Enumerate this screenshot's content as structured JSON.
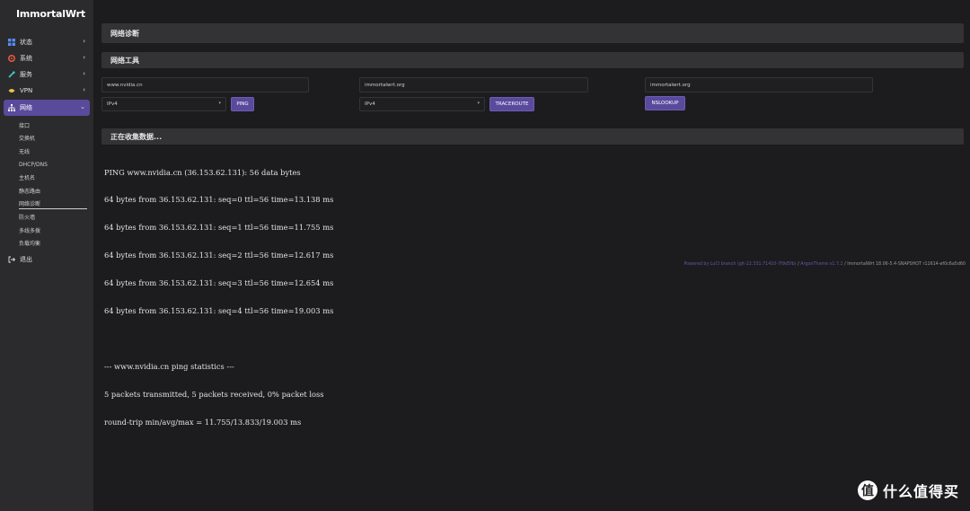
{
  "brand": "ImmortalWrt",
  "sidebar": {
    "items": [
      {
        "label": "状态",
        "icon": "status-icon"
      },
      {
        "label": "系统",
        "icon": "system-icon"
      },
      {
        "label": "服务",
        "icon": "services-icon"
      },
      {
        "label": "VPN",
        "icon": "vpn-icon"
      },
      {
        "label": "网络",
        "icon": "network-icon"
      }
    ],
    "network_sub": [
      "接口",
      "交换机",
      "无线",
      "DHCP/DNS",
      "主机名",
      "静态路由",
      "网络诊断",
      "防火墙",
      "多线多拨",
      "负载均衡"
    ],
    "logout": "退出"
  },
  "page": {
    "title": "网络诊断",
    "tools_title": "网络工具",
    "collecting": "正在收集数据..."
  },
  "tools": {
    "ping": {
      "host": "www.nvidia.cn",
      "proto": "IPv4",
      "button": "PING"
    },
    "traceroute": {
      "host": "immortalwrt.org",
      "proto": "IPv4",
      "button": "TRACEROUTE"
    },
    "nslookup": {
      "host": "immortalwrt.org",
      "button": "NSLOOKUP"
    }
  },
  "output": [
    "PING www.nvidia.cn (36.153.62.131): 56 data bytes",
    "64 bytes from 36.153.62.131: seq=0 ttl=56 time=13.138 ms",
    "64 bytes from 36.153.62.131: seq=1 ttl=56 time=11.755 ms",
    "64 bytes from 36.153.62.131: seq=2 ttl=56 time=12.617 ms",
    "64 bytes from 36.153.62.131: seq=3 ttl=56 time=12.654 ms",
    "64 bytes from 36.153.62.131: seq=4 ttl=56 time=19.003 ms",
    "",
    "--- www.nvidia.cn ping statistics ---",
    "5 packets transmitted, 5 packets received, 0% packet loss",
    "round-trip min/avg/max = 11.755/13.833/19.003 ms"
  ],
  "footer": {
    "luci": "Powered by LuCI branch (git-22.331.71410-7f9d5fb)",
    "theme": "ArgonTheme v1.7.2",
    "version": "/ ImmortalWrt 18.06-5.4-SNAPSHOT r11614-ef0c6a5d60"
  },
  "watermark": {
    "badge": "值",
    "text": "什么值得买"
  },
  "colors": {
    "accent": "#5a4a9c",
    "sidebar": "#2b2b2d",
    "background": "#1c1c1e"
  }
}
